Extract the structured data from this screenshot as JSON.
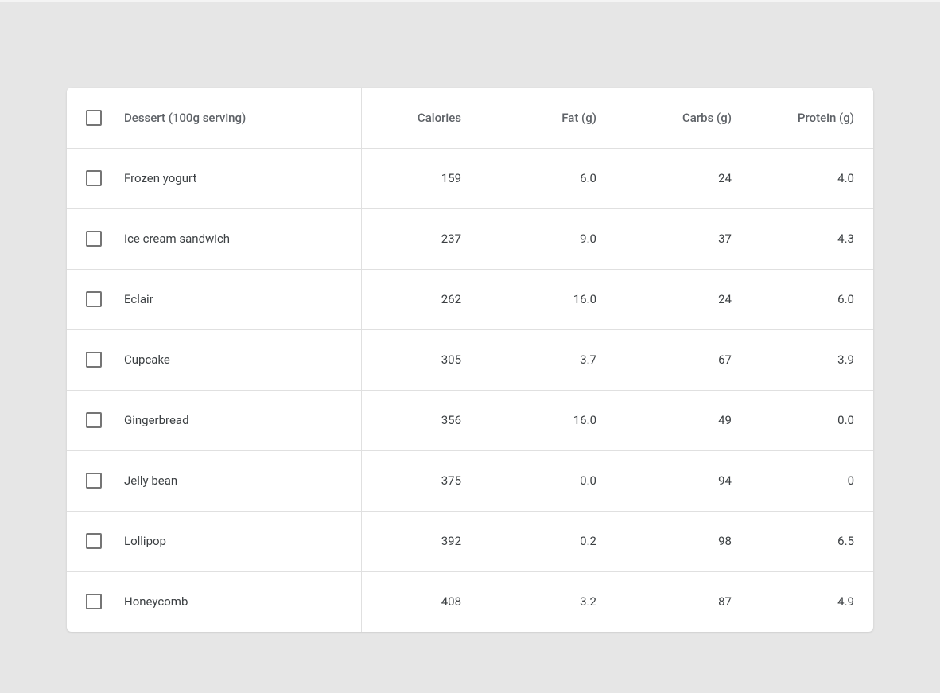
{
  "table": {
    "headers": {
      "name": "Dessert (100g serving)",
      "calories": "Calories",
      "fat": "Fat (g)",
      "carbs": "Carbs (g)",
      "protein": "Protein (g)"
    },
    "rows": [
      {
        "name": "Frozen yogurt",
        "calories": "159",
        "fat": "6.0",
        "carbs": "24",
        "protein": "4.0"
      },
      {
        "name": "Ice cream sandwich",
        "calories": "237",
        "fat": "9.0",
        "carbs": "37",
        "protein": "4.3"
      },
      {
        "name": "Eclair",
        "calories": "262",
        "fat": "16.0",
        "carbs": "24",
        "protein": "6.0"
      },
      {
        "name": "Cupcake",
        "calories": "305",
        "fat": "3.7",
        "carbs": "67",
        "protein": "3.9"
      },
      {
        "name": "Gingerbread",
        "calories": "356",
        "fat": "16.0",
        "carbs": "49",
        "protein": "0.0"
      },
      {
        "name": "Jelly bean",
        "calories": "375",
        "fat": "0.0",
        "carbs": "94",
        "protein": "0"
      },
      {
        "name": "Lollipop",
        "calories": "392",
        "fat": "0.2",
        "carbs": "98",
        "protein": "6.5"
      },
      {
        "name": "Honeycomb",
        "calories": "408",
        "fat": "3.2",
        "carbs": "87",
        "protein": "4.9"
      }
    ]
  }
}
